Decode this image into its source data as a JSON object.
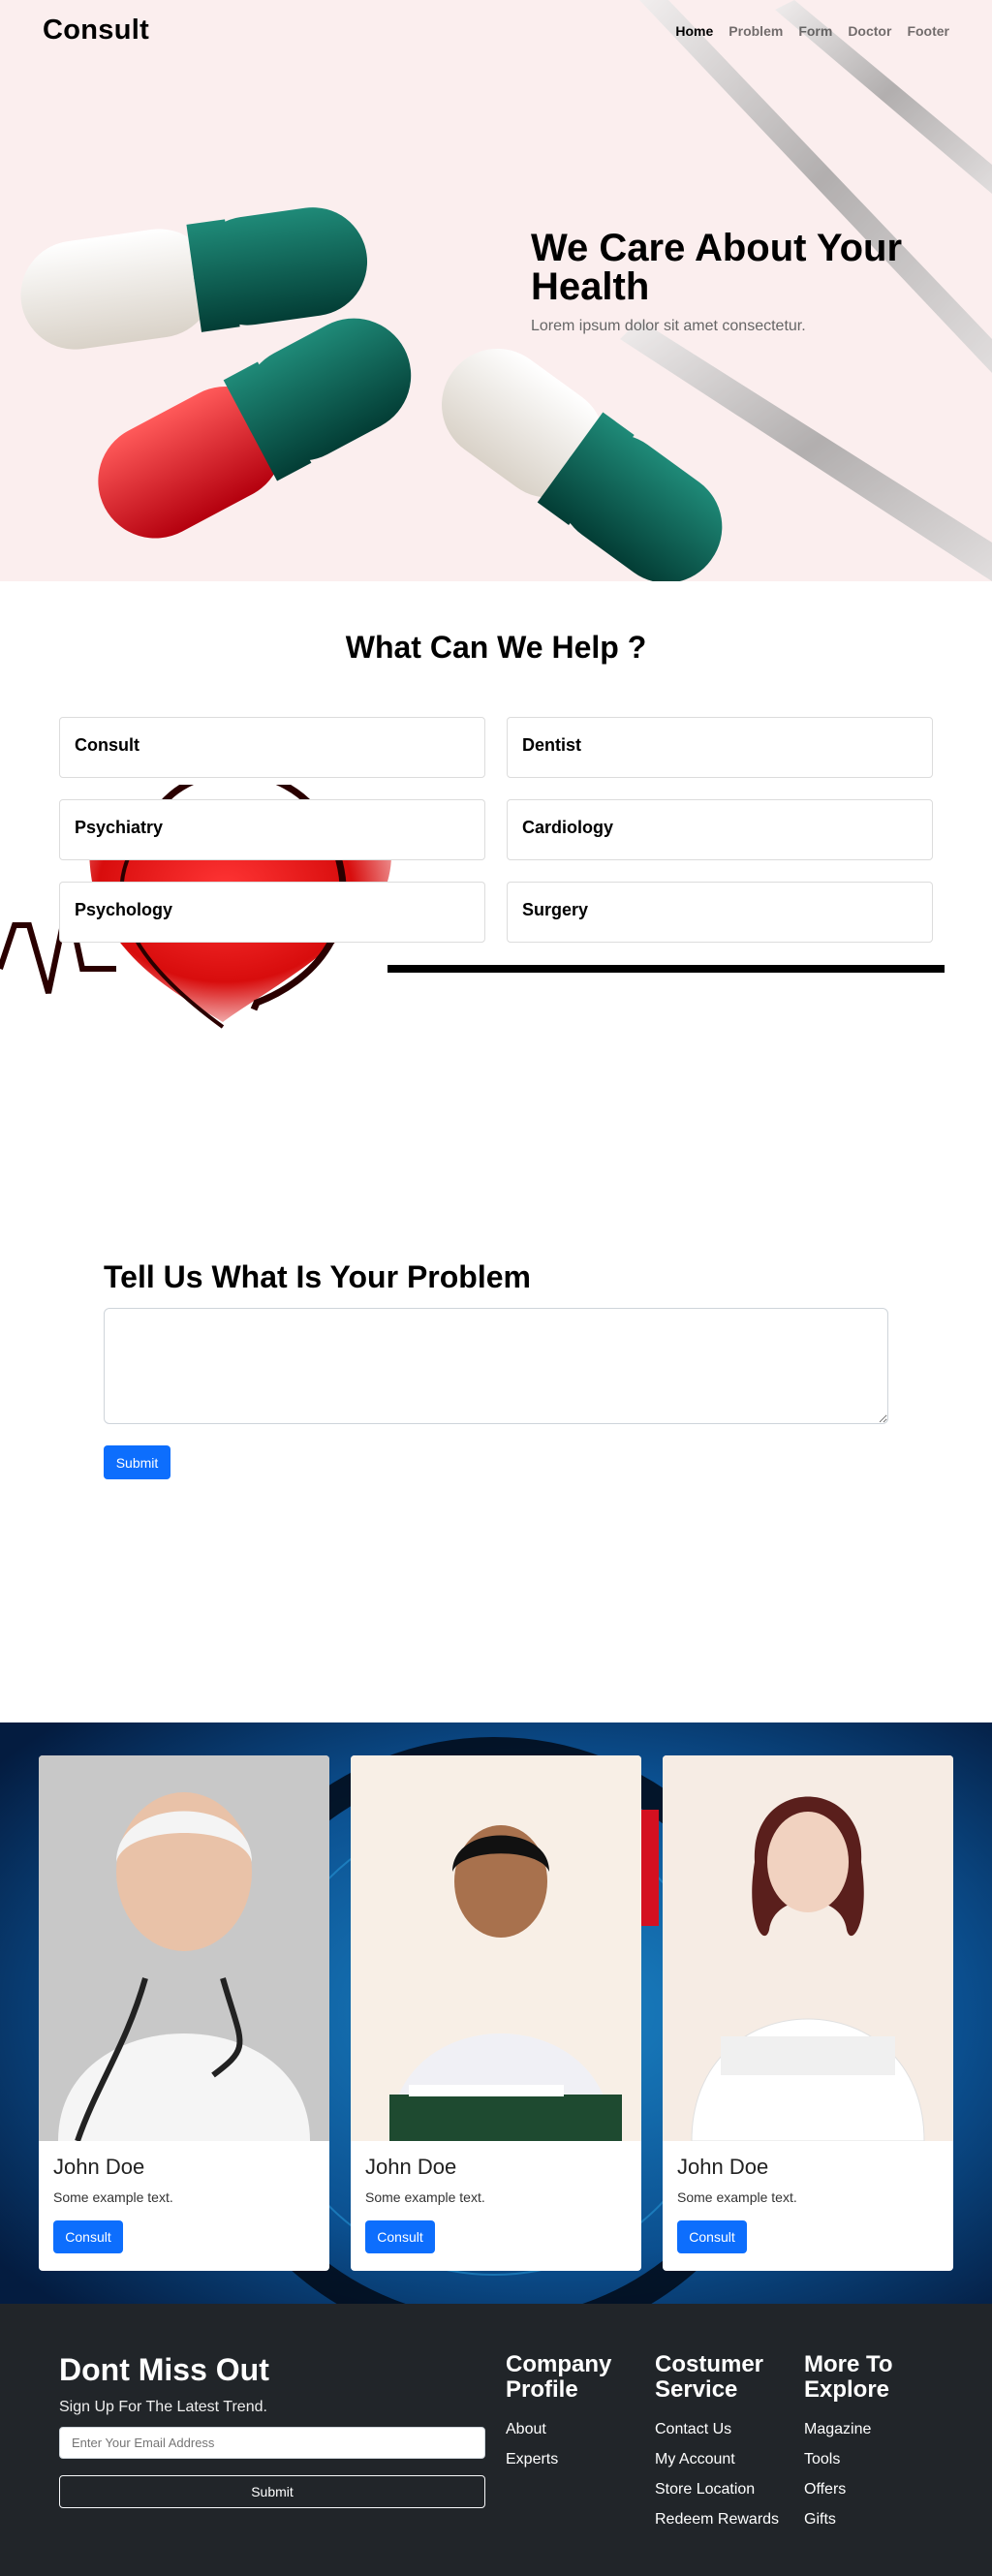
{
  "nav": {
    "brand": "Consult",
    "links": [
      "Home",
      "Problem",
      "Form",
      "Doctor",
      "Footer"
    ]
  },
  "hero": {
    "title": "We Care About Your Health",
    "subtitle": "Lorem ipsum dolor sit amet consectetur."
  },
  "help": {
    "title": "What Can We Help ?",
    "items": [
      "Consult",
      "Dentist",
      "Psychiatry",
      "Cardiology",
      "Psychology",
      "Surgery"
    ]
  },
  "problem": {
    "title": "Tell Us What Is Your Problem",
    "textarea_value": "",
    "submit_label": "Submit"
  },
  "doctors": [
    {
      "name": "John Doe",
      "text": "Some example text.",
      "button": "Consult"
    },
    {
      "name": "John Doe",
      "text": "Some example text.",
      "button": "Consult"
    },
    {
      "name": "John Doe",
      "text": "Some example text.",
      "button": "Consult"
    }
  ],
  "footer": {
    "title": "Dont Miss Out",
    "subtitle": "Sign Up For The Latest Trend.",
    "email_placeholder": "Enter Your Email Address",
    "submit_label": "Submit",
    "columns": [
      {
        "title": "Company Profile",
        "links": [
          "About",
          "Experts"
        ]
      },
      {
        "title": "Costumer Service",
        "links": [
          "Contact Us",
          "My Account",
          "Store Location",
          "Redeem Rewards"
        ]
      },
      {
        "title": "More To Explore",
        "links": [
          "Magazine",
          "Tools",
          "Offers",
          "Gifts"
        ]
      }
    ]
  },
  "colors": {
    "primary": "#0d6efd",
    "footer_bg": "#212529",
    "hero_bg": "#fbeeee",
    "doctors_bg": "#072c5a"
  }
}
